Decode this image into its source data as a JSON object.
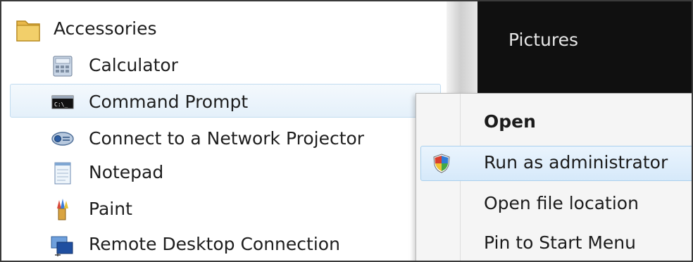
{
  "menu": {
    "folder": {
      "label": "Accessories",
      "icon": "folder-icon"
    },
    "items": [
      {
        "label": "Calculator",
        "icon": "calculator-icon"
      },
      {
        "label": "Command Prompt",
        "icon": "command-prompt-icon",
        "highlighted": true
      },
      {
        "label": "Connect to a Network Projector",
        "icon": "network-projector-icon"
      },
      {
        "label": "Notepad",
        "icon": "notepad-icon"
      },
      {
        "label": "Paint",
        "icon": "paint-icon"
      },
      {
        "label": "Remote Desktop Connection",
        "icon": "remote-desktop-icon"
      }
    ]
  },
  "right_pane": {
    "pictures_label": "Pictures"
  },
  "context_menu": {
    "items": [
      {
        "label": "Open",
        "bold": true
      },
      {
        "label": "Run as administrator",
        "icon": "shield-icon",
        "highlighted": true
      },
      {
        "label": "Open file location"
      },
      {
        "label": "Pin to Start Menu"
      }
    ]
  },
  "colors": {
    "highlight_border": "#a9d0ee",
    "highlight_fill": "#d6e9fa",
    "dark_pane": "#101010"
  }
}
